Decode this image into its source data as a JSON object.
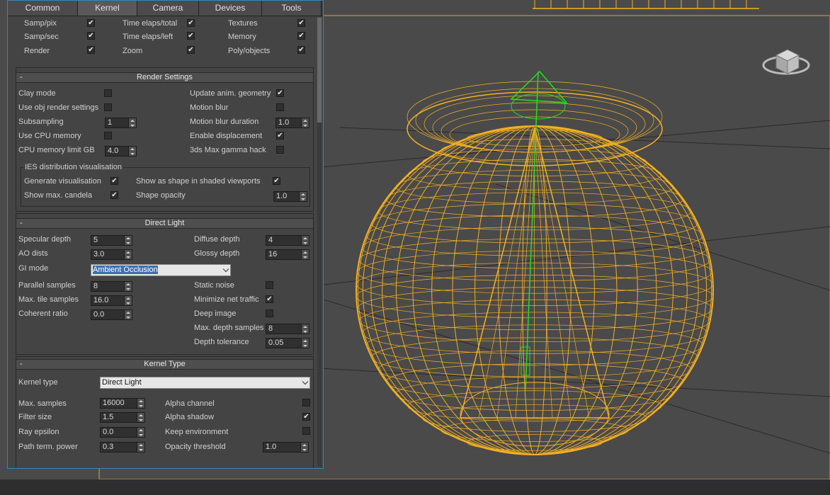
{
  "tabs": [
    "Common",
    "Kernel",
    "Camera",
    "Devices",
    "Tools"
  ],
  "active_tab": "Kernel",
  "stats": {
    "col1": [
      {
        "label": "Samp/pix",
        "checked": true
      },
      {
        "label": "Samp/sec",
        "checked": true
      },
      {
        "label": "Render",
        "checked": true
      }
    ],
    "col2": [
      {
        "label": "Time elaps/total",
        "checked": true
      },
      {
        "label": "Time elaps/left",
        "checked": true
      },
      {
        "label": "Zoom",
        "checked": true
      }
    ],
    "col3": [
      {
        "label": "Textures",
        "checked": true
      },
      {
        "label": "Memory",
        "checked": true
      },
      {
        "label": "Poly/objects",
        "checked": true
      }
    ]
  },
  "render_settings": {
    "title": "Render Settings",
    "collapse": "-",
    "clay_mode": "Clay mode",
    "use_obj": "Use obj render settings",
    "subsampling": "Subsampling",
    "subsampling_val": "1",
    "use_cpu": "Use CPU memory",
    "cpu_limit": "CPU memory limit GB",
    "cpu_limit_val": "4.0",
    "update_anim": "Update anim. geometry",
    "motion_blur": "Motion blur",
    "motion_blur_dur": "Motion blur duration",
    "motion_blur_dur_val": "1.0",
    "enable_disp": "Enable displacement",
    "gamma_hack": "3ds Max gamma hack",
    "ies_group": "IES distribution visualisation",
    "gen_vis": "Generate visualisation",
    "show_max": "Show max. candela",
    "show_shape": "Show as shape in shaded viewports",
    "shape_opacity": "Shape opacity",
    "shape_opacity_val": "1.0"
  },
  "direct_light": {
    "title": "Direct Light",
    "collapse": "-",
    "specular_depth": "Specular depth",
    "specular_depth_val": "5",
    "ao_dists": "AO dists",
    "ao_dists_val": "3.0",
    "gi_mode": "GI mode",
    "gi_mode_val": "Ambient Occlusion",
    "parallel_samples": "Parallel samples",
    "parallel_samples_val": "8",
    "max_tile": "Max. tile samples",
    "max_tile_val": "16.0",
    "coherent": "Coherent ratio",
    "coherent_val": "0.0",
    "diffuse_depth": "Diffuse depth",
    "diffuse_depth_val": "4",
    "glossy_depth": "Glossy depth",
    "glossy_depth_val": "16",
    "static_noise": "Static noise",
    "min_net": "Minimize net traffic",
    "deep_image": "Deep image",
    "max_depth_samples": "Max. depth samples",
    "max_depth_samples_val": "8",
    "depth_tol": "Depth tolerance",
    "depth_tol_val": "0.05"
  },
  "kernel_type": {
    "title": "Kernel Type",
    "collapse": "-",
    "kernel_type": "Kernel type",
    "kernel_type_val": "Direct Light",
    "max_samples": "Max. samples",
    "max_samples_val": "16000",
    "filter_size": "Filter size",
    "filter_size_val": "1.5",
    "ray_eps": "Ray epsilon",
    "ray_eps_val": "0.0",
    "path_term": "Path term. power",
    "path_term_val": "0.3",
    "alpha_channel": "Alpha channel",
    "alpha_shadow": "Alpha shadow",
    "keep_env": "Keep environment",
    "opacity_thr": "Opacity threshold",
    "opacity_thr_val": "1.0"
  },
  "check": "✔",
  "colors": {
    "wire": "#f5b022",
    "light": "#22e022",
    "accent": "#2e88c8"
  }
}
